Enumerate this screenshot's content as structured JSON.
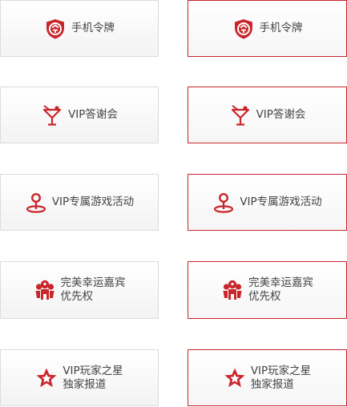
{
  "accent_color": "#c9262c",
  "rows": [
    {
      "icon": "shield-token-icon",
      "lines": [
        "手机令牌"
      ]
    },
    {
      "icon": "cocktail-glass-icon",
      "lines": [
        "VIP答谢会"
      ]
    },
    {
      "icon": "location-pin-icon",
      "lines": [
        "VIP专属游戏活动"
      ]
    },
    {
      "icon": "guests-icon",
      "lines": [
        "完美幸运嘉宾",
        "优先权"
      ]
    },
    {
      "icon": "star-badge-icon",
      "lines": [
        "VIP玩家之星",
        "独家报道"
      ]
    }
  ]
}
